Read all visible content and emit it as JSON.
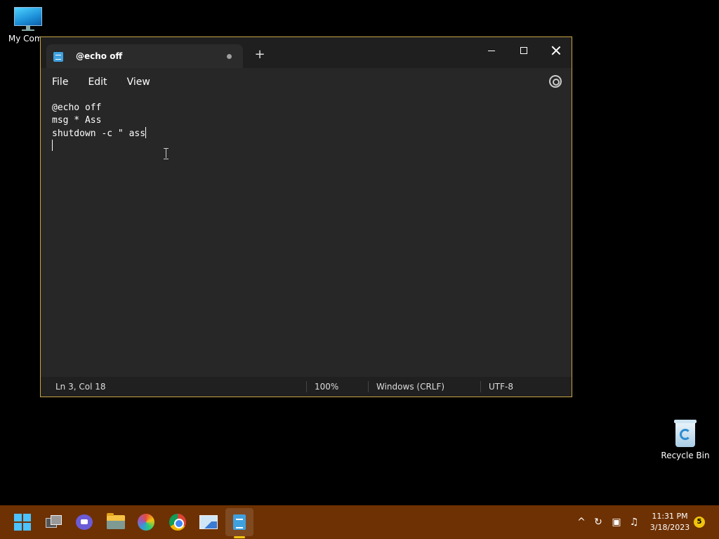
{
  "desktop": {
    "icons": [
      {
        "label": "My Comp",
        "icon": "computer-icon"
      },
      {
        "label": "Recycle Bin",
        "icon": "recycle-bin-icon"
      }
    ]
  },
  "window": {
    "tab_title": "@echo off",
    "new_tab_label": "+",
    "menu": [
      "File",
      "Edit",
      "View"
    ],
    "editor_lines": [
      "@echo off",
      "msg * Ass",
      "shutdown -c \" ass",
      ""
    ],
    "status": {
      "position": "Ln 3, Col 18",
      "zoom": "100%",
      "line_ending": "Windows (CRLF)",
      "encoding": "UTF-8"
    }
  },
  "taskbar": {
    "apps": [
      "start-icon",
      "task-view-icon",
      "chat-icon",
      "file-explorer-icon",
      "paint-icon",
      "chrome-icon",
      "photos-icon",
      "notepad-icon"
    ],
    "tray": [
      "chevron-up-icon",
      "sync-icon",
      "network-icon",
      "volume-icon"
    ],
    "time": "11:31 PM",
    "date": "3/18/2023",
    "notification_count": "5"
  },
  "colors": {
    "window_border": "#c9a544",
    "taskbar": "#6e3103",
    "editor_bg": "#272727"
  }
}
